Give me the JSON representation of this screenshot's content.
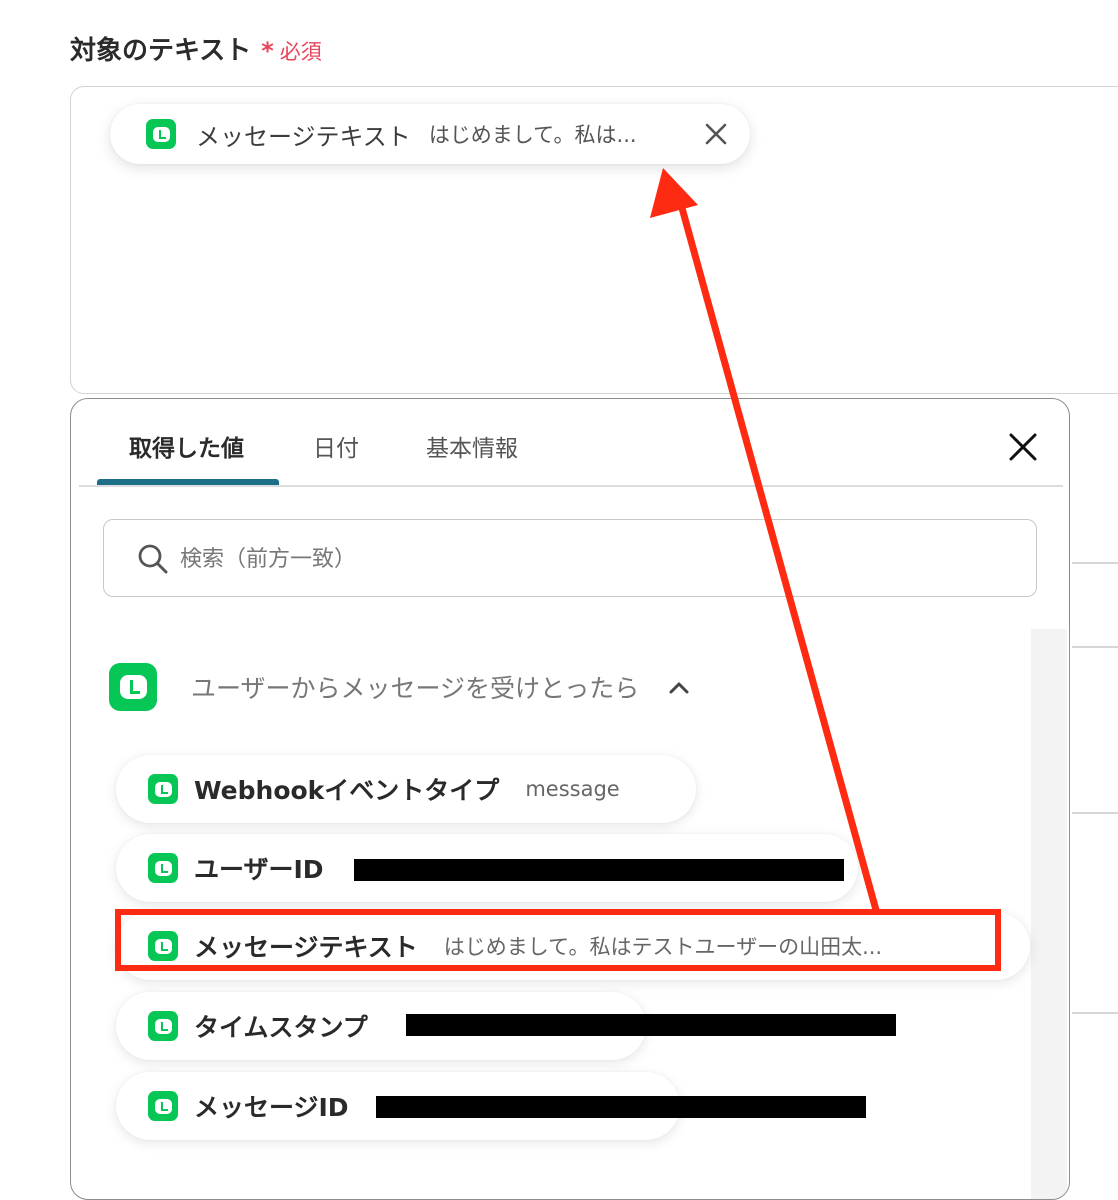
{
  "field": {
    "label": "対象のテキスト",
    "required_mark": "*",
    "required_text": "必須"
  },
  "selected_chip": {
    "icon": "line-icon",
    "label": "メッセージテキスト",
    "value": "はじめまして。私は..."
  },
  "picker": {
    "tabs": [
      {
        "label": "取得した値",
        "active": true
      },
      {
        "label": "日付",
        "active": false
      },
      {
        "label": "基本情報",
        "active": false
      }
    ],
    "search_placeholder": "検索（前方一致）",
    "group": {
      "title": "ユーザーからメッセージを受けとったら",
      "expanded": true
    },
    "items": [
      {
        "label": "Webhookイベントタイプ",
        "value": "message",
        "redacted": false,
        "highlighted": false
      },
      {
        "label": "ユーザーID",
        "value": "",
        "redacted": true,
        "highlighted": false
      },
      {
        "label": "メッセージテキスト",
        "value": "はじめまして。私はテストユーザーの山田太...",
        "redacted": false,
        "highlighted": true
      },
      {
        "label": "タイムスタンプ",
        "value": "",
        "redacted": true,
        "highlighted": false
      },
      {
        "label": "メッセージID",
        "value": "",
        "redacted": true,
        "highlighted": false
      }
    ]
  },
  "colors": {
    "line_green": "#06c755",
    "required_red": "#e8445a",
    "annotation_red": "#ff2a12",
    "tab_underline": "#1d6e89"
  }
}
